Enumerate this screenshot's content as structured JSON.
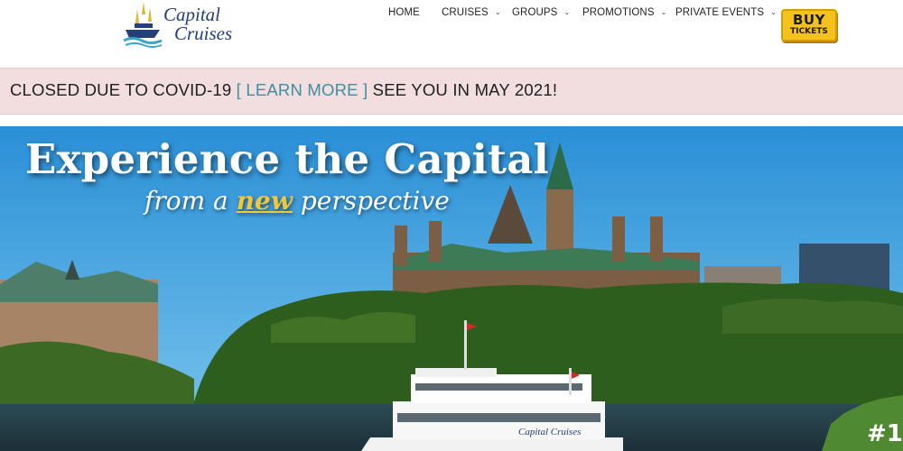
{
  "brand": {
    "line1": "Capital",
    "line2": "Cruises",
    "color": "#23407a"
  },
  "nav": {
    "items": [
      {
        "label": "HOME",
        "has_dropdown": false
      },
      {
        "label": "CRUISES",
        "has_dropdown": true
      },
      {
        "label": "GROUPS",
        "has_dropdown": true
      },
      {
        "label": "PROMOTIONS",
        "has_dropdown": true
      },
      {
        "label": "PRIVATE EVENTS",
        "has_dropdown": true
      }
    ],
    "chevron": "⌄"
  },
  "buy_button": {
    "line1": "BUY",
    "line2": "TICKETS",
    "color": "#f4c21a"
  },
  "alert": {
    "before": "CLOSED DUE TO COVID-19 ",
    "link": "[ LEARN MORE ]",
    "after": " SEE YOU IN MAY 2021!",
    "background": "#f2dede",
    "link_color": "#3e8fa0"
  },
  "hero": {
    "title": "Experience the Capital",
    "sub_before": "from a ",
    "sub_accent": "new",
    "sub_after": " perspective",
    "boat_name": "Capital Cruises",
    "badge": "#1"
  }
}
